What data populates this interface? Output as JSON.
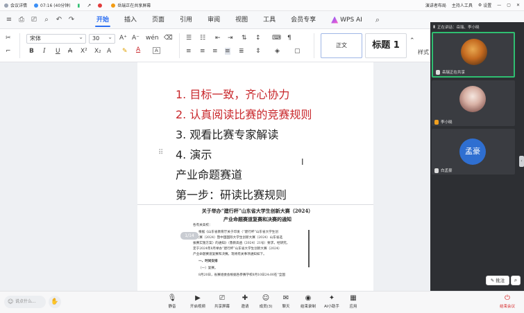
{
  "topbar": {
    "meeting_info": "会议详情",
    "timer": "07:16 (40分钟)",
    "sharing": "岳瑞正在共享屏幕",
    "speaker_view": "演讲者布局",
    "host_tools": "主持人工具",
    "settings": "设置"
  },
  "tabs": [
    "开始",
    "插入",
    "页面",
    "引用",
    "审阅",
    "视图",
    "工具",
    "会员专享"
  ],
  "wps_ai": "WPS AI",
  "ribbon": {
    "font_name": "宋体",
    "font_size": "30",
    "style_normal": "正文",
    "style_heading": "标题 1",
    "style_label": "样式"
  },
  "document": {
    "lines": [
      {
        "text": "1.  目标一致，齐心协力",
        "color": "#c8262a"
      },
      {
        "text": "2.  认真阅读比赛的竞赛规则",
        "color": "#c8262a"
      },
      {
        "text": "3.  观看比赛专家解读",
        "color": "#222222"
      },
      {
        "text": "4.  演示",
        "color": "#222222"
      },
      {
        "text": "产业命题赛道",
        "color": "#222222"
      },
      {
        "text": "第一步：研读比赛规则",
        "color": "#222222"
      }
    ],
    "notice_title1": "关于举办“建行杯”山东省大学生创新大赛（2024）",
    "notice_title2": "产业命题赛道复赛和决赛的通知",
    "notice_paras": [
      "各有关高校：",
      "根据《山东省教育厅关于印发〈“建行杯”山东省大学生创",
      "新大赛（2024）暨中国国际大学生创新大赛（2024）山东省选",
      "拔赛实施方案〉的通知》（鲁教高函〔2024〕21号）要求，经研究，",
      "定于2024年8月举办“建行杯”山东省大学生创新大赛（2024）",
      "产业命题赛道复赛和决赛。现将有关事项通知如下。",
      "一、时间安排",
      "（一）复赛。",
      "8月20日，省赛组委会根据各参赛学校8月10日24:00在“全国"
    ],
    "page_badge": "1/14"
  },
  "participants": {
    "header": "正在讲话：岳瑞、李小晓",
    "tiles": [
      {
        "name": "岳瑞正在共享"
      },
      {
        "name": "李小晓"
      },
      {
        "name": "白孟豪",
        "initials": "孟豪"
      }
    ]
  },
  "annotate_label": "批注",
  "bottombar": {
    "chat_placeholder": "说点什么...",
    "buttons": [
      "静音",
      "开启视频",
      "共享屏幕",
      "邀请",
      "成员(3)",
      "聊天",
      "结束录制",
      "AI小助手",
      "应用"
    ],
    "leave": "结束会议"
  }
}
